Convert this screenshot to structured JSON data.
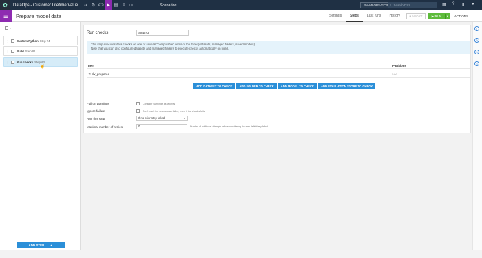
{
  "topbar": {
    "project": "DataOps - Customer Lifetime Value",
    "section": "Scenarios",
    "project_badge": "PM-MLOPS-GCP",
    "search_placeholder": "Search DSS..."
  },
  "header": {
    "title": "Prepare model data",
    "tabs": [
      {
        "label": "Settings",
        "active": false
      },
      {
        "label": "Steps",
        "active": true
      },
      {
        "label": "Last runs",
        "active": false
      },
      {
        "label": "History",
        "active": false
      }
    ],
    "abort_label": "ABORT",
    "run_label": "RUN",
    "actions_label": "ACTIONS"
  },
  "steps": {
    "items": [
      {
        "name": "Custom Python",
        "sub": "Step #4",
        "active": false
      },
      {
        "name": "Build",
        "sub": "Step #1",
        "active": false
      },
      {
        "name": "Run checks",
        "sub": "Step #3",
        "active": true
      }
    ],
    "add_step_label": "ADD STEP"
  },
  "editor": {
    "heading": "Run checks",
    "step_name_value": "Step #3",
    "info_line1": "This step executes data checks on one or several \"computable\" items of the Flow (datasets, managed folders, saved models).",
    "info_line2": "Note that you can also configure datasets and managed folders to execute checks automatically on build.",
    "col_item": "Item",
    "col_partitions": "Partitions",
    "row_item": "clv_prepared",
    "row_partition": "N/A",
    "buttons": {
      "dataset": "ADD DATASET TO CHECK",
      "folder": "ADD FOLDER TO CHECK",
      "model": "ADD MODEL TO CHECK",
      "eval": "ADD EVALUATION STORE TO CHECK"
    },
    "fail_label": "Fail on warnings",
    "fail_hint": "Consider warnings as failures",
    "ignore_label": "Ignore failure",
    "ignore_hint": "Don't mark the scenario as failed, even if the checks fails",
    "run_step_label": "Run this step",
    "run_step_value": "If no prior step failed",
    "retries_label": "Maximal number of retries",
    "retries_value": "0",
    "retries_hint": "Number of additional attempts before considering the step definitively failed"
  },
  "colors": {
    "topbar": "#1f3044",
    "accent_purple": "#8e2bb1",
    "primary_blue": "#2b8fd8",
    "run_green": "#5dbb3a",
    "info_bg": "#e5f3fb"
  }
}
